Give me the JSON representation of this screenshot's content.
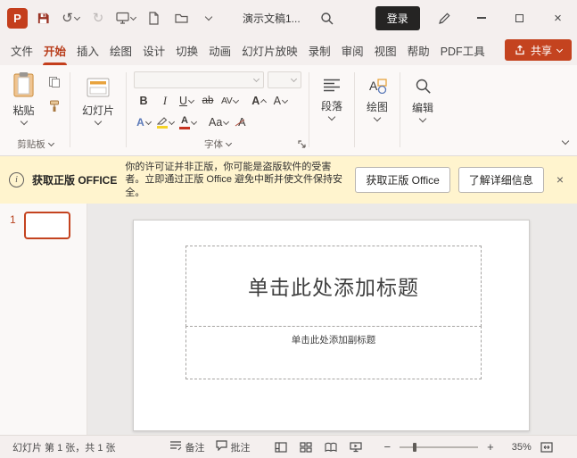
{
  "titlebar": {
    "document_title": "演示文稿1...",
    "login_label": "登录"
  },
  "icons": {
    "app_logo": "P",
    "undo": "↺",
    "redo": "↻",
    "close": "×",
    "zoom_out": "−",
    "zoom_in": "+",
    "info": "i"
  },
  "ribbon": {
    "tabs": [
      {
        "label": "文件"
      },
      {
        "label": "开始"
      },
      {
        "label": "插入"
      },
      {
        "label": "绘图"
      },
      {
        "label": "设计"
      },
      {
        "label": "切换"
      },
      {
        "label": "动画"
      },
      {
        "label": "幻灯片放映"
      },
      {
        "label": "录制"
      },
      {
        "label": "审阅"
      },
      {
        "label": "视图"
      },
      {
        "label": "帮助"
      },
      {
        "label": "PDF工具"
      }
    ],
    "active_tab": "开始",
    "share_label": "共享",
    "paste_label": "粘贴",
    "clipboard_group_label": "剪贴板",
    "slides_button_label": "幻灯片",
    "font_group_label": "字体",
    "paragraph_button_label": "段落",
    "drawing_button_label": "绘图",
    "editing_button_label": "编辑",
    "font_icons": {
      "bold": "B",
      "italic": "I",
      "underline": "U",
      "strikethrough": "ab",
      "char_spacing": "AV",
      "grow_font": "A",
      "shrink_font": "A",
      "text_effects": "A",
      "font_color": "A",
      "change_case": "Aa",
      "clear_formatting": "A"
    }
  },
  "license_bar": {
    "title": "获取正版 OFFICE",
    "message": "你的许可证并非正版，你可能是盗版软件的受害者。立即通过正版 Office 避免中断并使文件保持安全。",
    "primary_button": "获取正版 Office",
    "secondary_button": "了解详细信息"
  },
  "slide_panel": {
    "slide_number": "1"
  },
  "slide": {
    "title_placeholder": "单击此处添加标题",
    "subtitle_placeholder": "单击此处添加副标题"
  },
  "status_bar": {
    "slide_indicator": "幻灯片 第 1 张，共 1 张",
    "notes_label": "备注",
    "comments_label": "批注",
    "zoom_level": "35%"
  },
  "colors": {
    "accent": "#C43E1C",
    "share_button": "#C4431F",
    "license_bg": "#FFF4CE",
    "login_bg": "#252423",
    "canvas_bg": "#EBE9E8"
  }
}
